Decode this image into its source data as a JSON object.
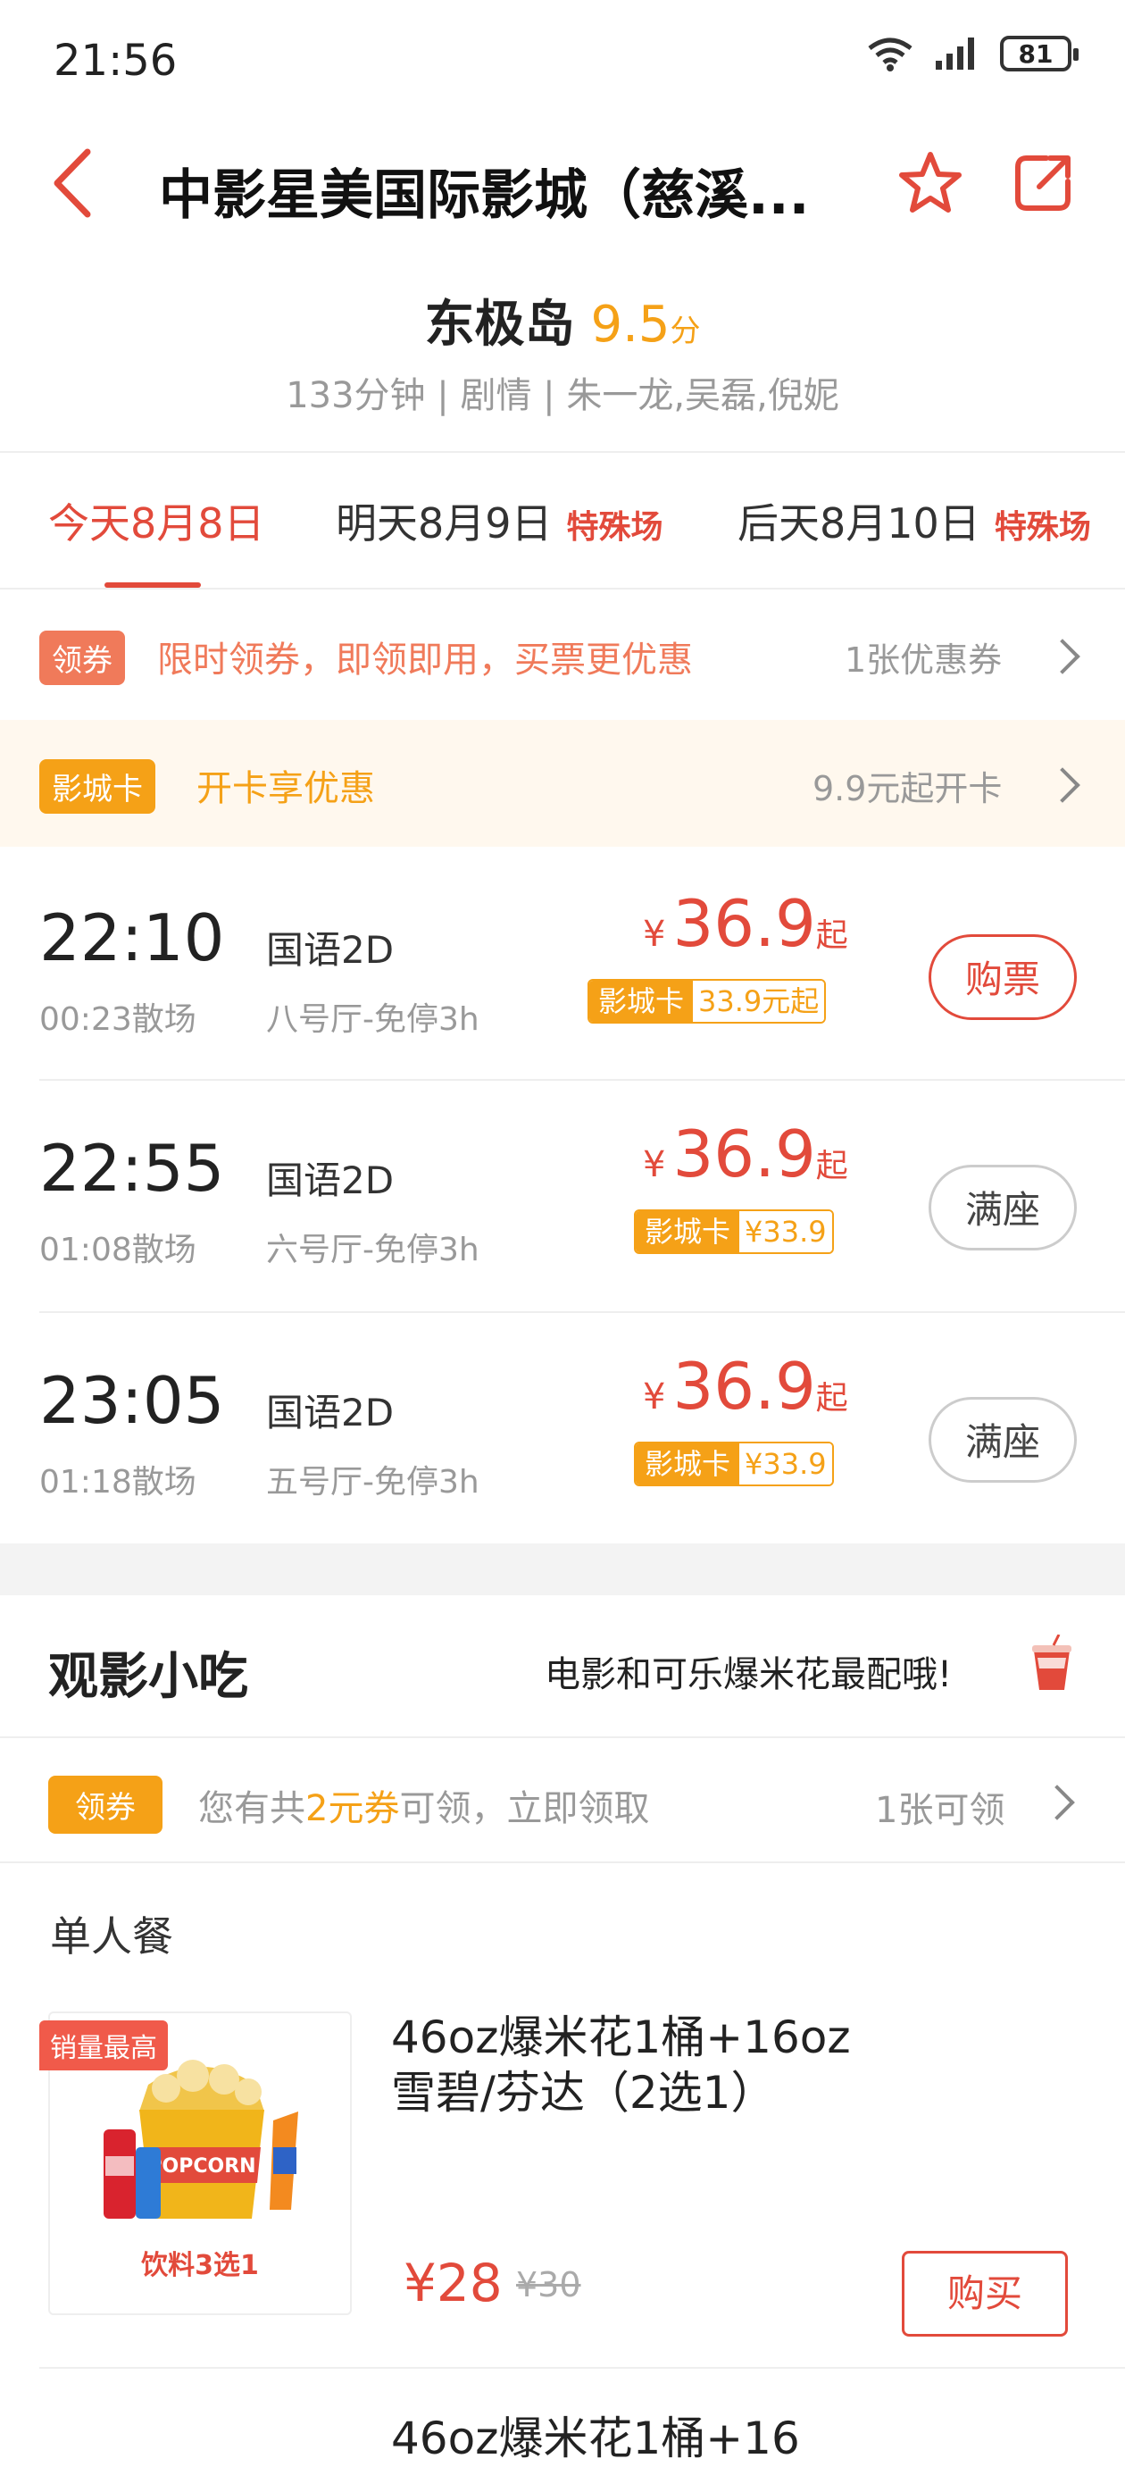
{
  "status": {
    "time": "21:56",
    "battery": "81"
  },
  "header": {
    "title": "中影星美国际影城（慈溪..."
  },
  "movie": {
    "name": "东极岛",
    "score": "9.5",
    "score_unit": "分",
    "meta": "133分钟 | 剧情 | 朱一龙,吴磊,倪妮"
  },
  "dates": [
    {
      "label": "今天8月8日",
      "special": ""
    },
    {
      "label": "明天8月9日",
      "special": "特殊场"
    },
    {
      "label": "后天8月10日",
      "special": "特殊场"
    }
  ],
  "coupon": {
    "tag": "领券",
    "text": "限时领券，即领即用，买票更优惠",
    "right": "1张优惠券"
  },
  "card": {
    "tag": "影城卡",
    "text": "开卡享优惠",
    "right": "9.9元起开卡"
  },
  "shows": [
    {
      "time": "22:10",
      "end": "00:23散场",
      "lang": "国语2D",
      "hall": "八号厅-免停3h",
      "yen": "¥",
      "price": "36.9",
      "qi": "起",
      "card_label": "影城卡",
      "card_price": "33.9元起",
      "button": "购票",
      "available": true
    },
    {
      "time": "22:55",
      "end": "01:08散场",
      "lang": "国语2D",
      "hall": "六号厅-免停3h",
      "yen": "¥",
      "price": "36.9",
      "qi": "起",
      "card_label": "影城卡",
      "card_price": "¥33.9",
      "button": "满座",
      "available": false
    },
    {
      "time": "23:05",
      "end": "01:18散场",
      "lang": "国语2D",
      "hall": "五号厅-免停3h",
      "yen": "¥",
      "price": "36.9",
      "qi": "起",
      "card_label": "影城卡",
      "card_price": "¥33.9",
      "button": "满座",
      "available": false
    }
  ],
  "snacks": {
    "title": "观影小吃",
    "subtitle": "电影和可乐爆米花最配哦!",
    "coupon_tag": "领券",
    "coupon_pre": "您有共",
    "coupon_amount": "2元券",
    "coupon_post": "可领，立即领取",
    "coupon_right": "1张可领",
    "section": "单人餐",
    "combo": {
      "badge": "销量最高",
      "title_line1": "46oz爆米花1桶+16oz",
      "title_line2": "雪碧/芬达（2选1）",
      "price": "¥28",
      "old_price": "¥30",
      "button": "购买",
      "image_text": "饮料3选1",
      "popcorn_text": "POPCORN"
    },
    "next_peek": "46oz爆米花1桶+16"
  },
  "colors": {
    "accent": "#e24a3b",
    "orange": "#f5a117"
  }
}
